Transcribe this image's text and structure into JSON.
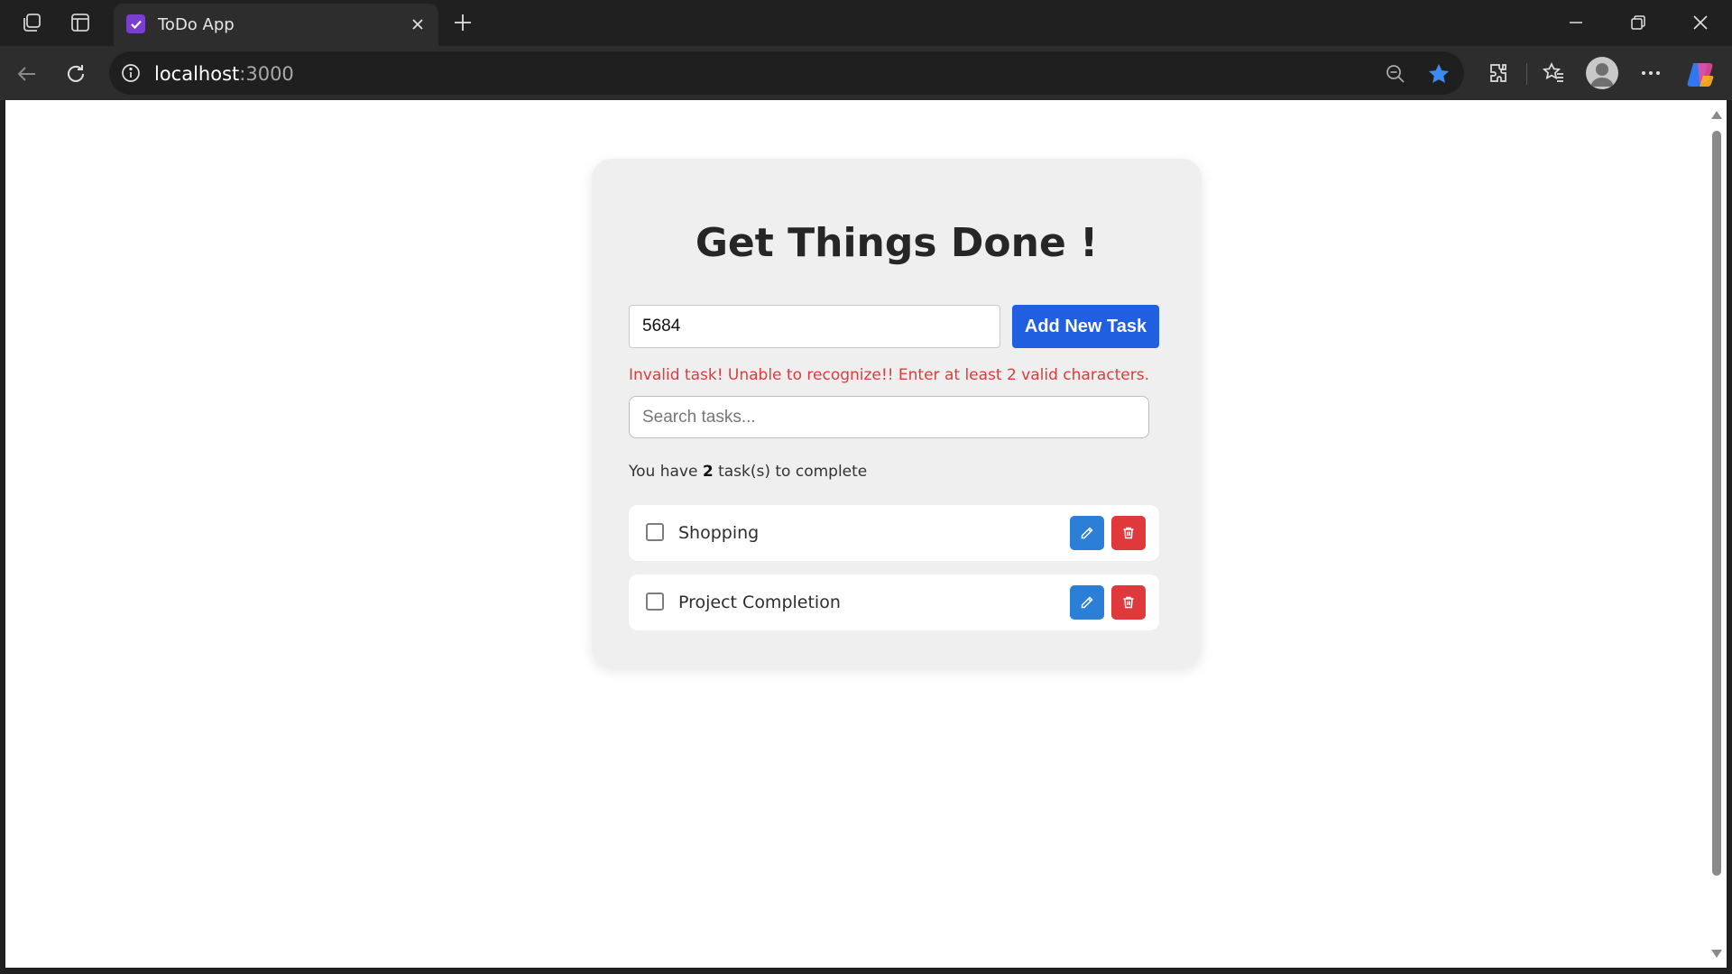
{
  "browser": {
    "tab_title": "ToDo App",
    "url_host": "localhost",
    "url_port": ":3000"
  },
  "app": {
    "title": "Get Things Done !",
    "task_input_value": "5684",
    "add_button_label": "Add New Task",
    "error_message": "Invalid task! Unable to recognize!! Enter at least 2 valid characters.",
    "search_placeholder": "Search tasks...",
    "count_prefix": "You have",
    "count_value": "2",
    "count_suffix": "task(s) to complete",
    "tasks": [
      {
        "label": "Shopping",
        "completed": false
      },
      {
        "label": "Project Completion",
        "completed": false
      }
    ]
  },
  "colors": {
    "accent": "#1f5fe0",
    "edit": "#2b7fd6",
    "delete": "#e0393b",
    "error": "#e03b3b",
    "card": "#efefef"
  },
  "icons": {
    "tab_favicon": "checkbox-icon",
    "edit": "pencil-icon",
    "delete": "trash-icon"
  }
}
